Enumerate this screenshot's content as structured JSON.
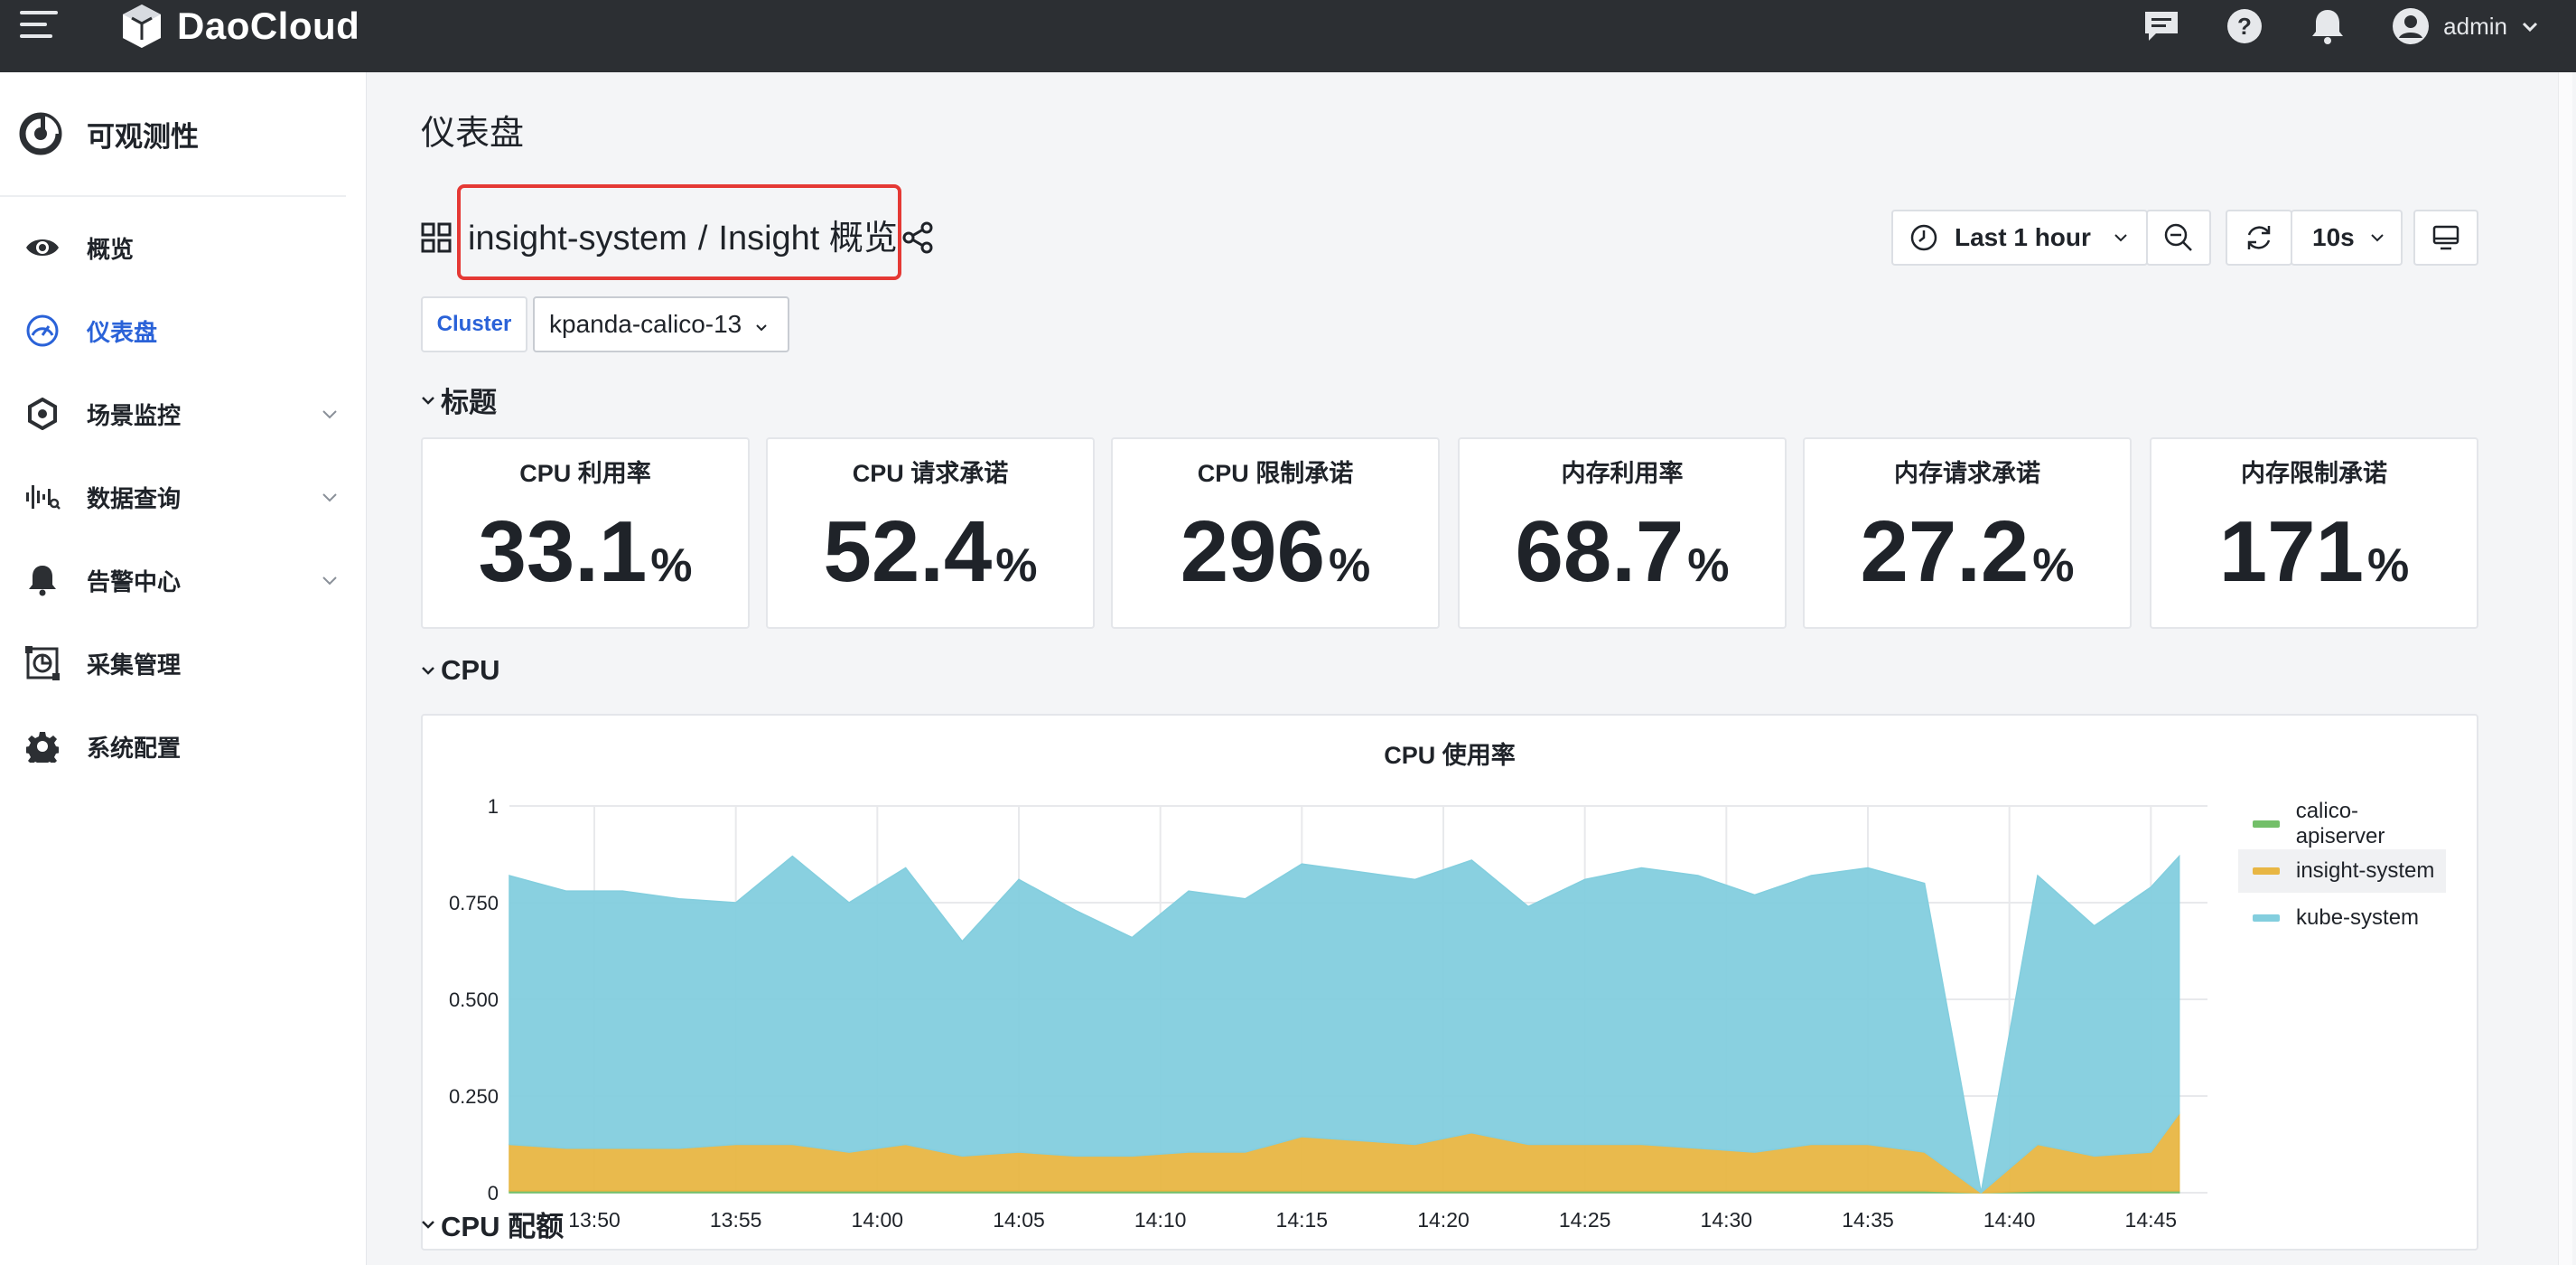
{
  "topbar": {
    "brand": "DaoCloud",
    "user": "admin",
    "icons": [
      "menu-icon",
      "message-icon",
      "help-icon",
      "bell-icon",
      "user-avatar-icon"
    ]
  },
  "sidebar": {
    "module_title": "可观测性",
    "items": [
      {
        "label": "概览",
        "icon": "eye-icon",
        "active": false,
        "expandable": false
      },
      {
        "label": "仪表盘",
        "icon": "dashboard-gauge-icon",
        "active": true,
        "expandable": false
      },
      {
        "label": "场景监控",
        "icon": "hexagon-icon",
        "active": false,
        "expandable": true
      },
      {
        "label": "数据查询",
        "icon": "waveform-icon",
        "active": false,
        "expandable": true
      },
      {
        "label": "告警中心",
        "icon": "bell-icon",
        "active": false,
        "expandable": true
      },
      {
        "label": "采集管理",
        "icon": "collect-icon",
        "active": false,
        "expandable": false
      },
      {
        "label": "系统配置",
        "icon": "gear-icon",
        "active": false,
        "expandable": false
      }
    ]
  },
  "page": {
    "title": "仪表盘",
    "breadcrumb": {
      "folder": "insight-system",
      "separator": "/",
      "dashboard": "Insight 概览"
    }
  },
  "toolbar": {
    "time_range": "Last 1 hour",
    "refresh_interval": "10s"
  },
  "variables": {
    "cluster_label": "Cluster",
    "cluster_value": "kpanda-calico-13"
  },
  "rows": {
    "row1": "标题",
    "row2": "CPU",
    "row3": "CPU 配额"
  },
  "stats": [
    {
      "title": "CPU 利用率",
      "value": "33.1",
      "unit": "%"
    },
    {
      "title": "CPU 请求承诺",
      "value": "52.4",
      "unit": "%"
    },
    {
      "title": "CPU 限制承诺",
      "value": "296",
      "unit": "%"
    },
    {
      "title": "内存利用率",
      "value": "68.7",
      "unit": "%"
    },
    {
      "title": "内存请求承诺",
      "value": "27.2",
      "unit": "%"
    },
    {
      "title": "内存限制承诺",
      "value": "171",
      "unit": "%"
    }
  ],
  "colors": {
    "accent": "#2a62d8",
    "highlight_box": "#e53935",
    "calico": "#73bf69",
    "insight": "#e8b643",
    "kube": "#83cede"
  },
  "chart_data": {
    "type": "area",
    "title": "CPU 使用率",
    "stacked": true,
    "ylim": [
      0,
      1
    ],
    "yticks": [
      "0",
      "0.250",
      "0.500",
      "0.750",
      "1"
    ],
    "xticks": [
      "13:50",
      "13:55",
      "14:00",
      "14:05",
      "14:10",
      "14:15",
      "14:20",
      "14:25",
      "14:30",
      "14:35",
      "14:40",
      "14:45"
    ],
    "x": [
      "13:47",
      "13:49",
      "13:51",
      "13:53",
      "13:55",
      "13:57",
      "13:59",
      "14:01",
      "14:03",
      "14:05",
      "14:07",
      "14:09",
      "14:11",
      "14:13",
      "14:15",
      "14:17",
      "14:19",
      "14:21",
      "14:23",
      "14:25",
      "14:27",
      "14:29",
      "14:31",
      "14:33",
      "14:35",
      "14:37",
      "14:39",
      "14:41",
      "14:43",
      "14:45",
      "14:46"
    ],
    "legend_position": "right",
    "grid": true,
    "series": [
      {
        "name": "calico-apiserver",
        "color": "#73bf69",
        "values": [
          0.005,
          0.005,
          0.005,
          0.005,
          0.005,
          0.005,
          0.005,
          0.005,
          0.005,
          0.005,
          0.005,
          0.005,
          0.005,
          0.005,
          0.005,
          0.005,
          0.005,
          0.005,
          0.005,
          0.005,
          0.005,
          0.005,
          0.005,
          0.005,
          0.005,
          0.005,
          0,
          0.005,
          0.005,
          0.005,
          0.005
        ]
      },
      {
        "name": "insight-system",
        "color": "#e8b643",
        "values": [
          0.12,
          0.11,
          0.11,
          0.11,
          0.12,
          0.12,
          0.1,
          0.12,
          0.09,
          0.1,
          0.09,
          0.09,
          0.1,
          0.1,
          0.14,
          0.13,
          0.12,
          0.15,
          0.12,
          0.12,
          0.12,
          0.11,
          0.1,
          0.12,
          0.12,
          0.1,
          0,
          0.12,
          0.09,
          0.1,
          0.2
        ]
      },
      {
        "name": "kube-system",
        "color": "#83cede",
        "values": [
          0.695,
          0.665,
          0.665,
          0.645,
          0.625,
          0.745,
          0.645,
          0.715,
          0.555,
          0.705,
          0.635,
          0.565,
          0.675,
          0.655,
          0.705,
          0.695,
          0.685,
          0.705,
          0.615,
          0.685,
          0.715,
          0.705,
          0.665,
          0.695,
          0.715,
          0.695,
          0,
          0.695,
          0.595,
          0.685,
          0.665
        ]
      }
    ]
  }
}
